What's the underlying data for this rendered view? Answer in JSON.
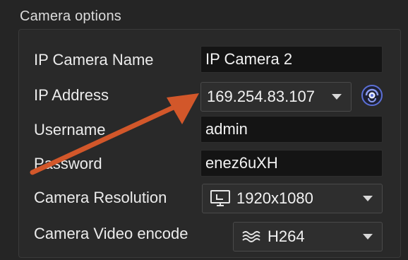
{
  "section": {
    "title": "Camera options"
  },
  "form": {
    "name_label": "IP Camera Name",
    "name_value": "IP Camera 2",
    "ip_label": "IP Address",
    "ip_value": "169.254.83.107",
    "username_label": "Username",
    "username_value": "admin",
    "password_label": "Password",
    "password_value": "enez6uXH",
    "resolution_label": "Camera Resolution",
    "resolution_value": "1920x1080",
    "encode_label": "Camera Video encode",
    "encode_value": "H264"
  },
  "icons": {
    "discover": "camera-discover-icon",
    "resolution": "monitor-icon",
    "encode": "wave-icon",
    "dropdown": "chevron-down-icon"
  },
  "colors": {
    "annotation_arrow": "#d2572a",
    "accent_blue": "#5b6fd6"
  }
}
